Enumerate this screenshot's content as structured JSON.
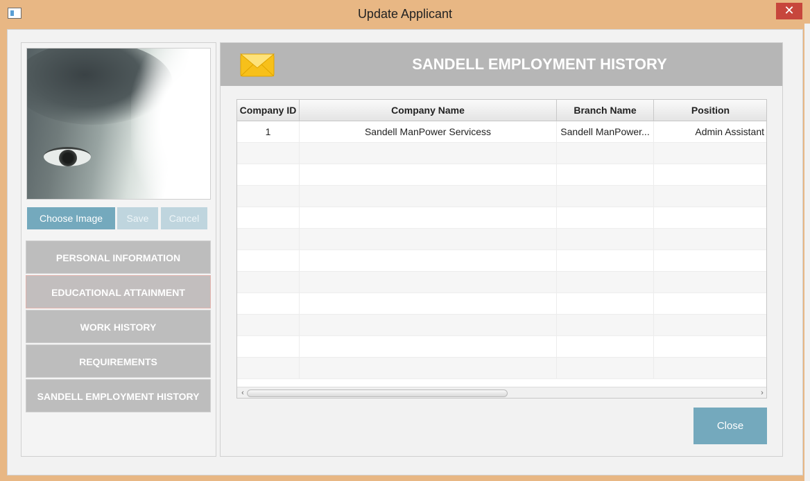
{
  "window": {
    "title": "Update Applicant",
    "close_glyph": "✕"
  },
  "photo_panel": {
    "buttons": {
      "choose": "Choose Image",
      "save": "Save",
      "cancel": "Cancel"
    }
  },
  "nav": {
    "items": [
      {
        "label": "PERSONAL INFORMATION"
      },
      {
        "label": "EDUCATIONAL ATTAINMENT"
      },
      {
        "label": "WORK HISTORY"
      },
      {
        "label": "REQUIREMENTS"
      },
      {
        "label": "SANDELL EMPLOYMENT HISTORY"
      }
    ]
  },
  "main": {
    "title": "SANDELL EMPLOYMENT HISTORY",
    "icon": "envelope-icon",
    "table": {
      "columns": [
        "Company ID",
        "Company Name",
        "Branch Name",
        "Position"
      ],
      "rows": [
        [
          "1",
          "Sandell ManPower Servicess",
          "Sandell ManPower...",
          "Admin Assistant"
        ]
      ]
    },
    "close_label": "Close"
  },
  "colors": {
    "accent": "#74a9bd",
    "frame": "#e8b784",
    "header": "#b6b6b6",
    "nav": "#bdbdbd",
    "close_red": "#c7463c"
  }
}
